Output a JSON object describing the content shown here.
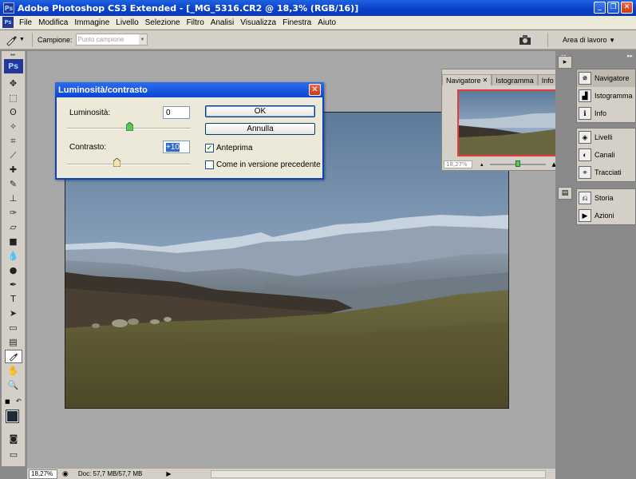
{
  "window": {
    "title": "Adobe Photoshop CS3 Extended - [_MG_5316.CR2 @ 18,3% (RGB/16)]",
    "app_icon_text": "Ps"
  },
  "menu": [
    "File",
    "Modifica",
    "Immagine",
    "Livello",
    "Selezione",
    "Filtro",
    "Analisi",
    "Visualizza",
    "Finestra",
    "Aiuto"
  ],
  "options_bar": {
    "sample_label": "Campione:",
    "sample_value": "Punto campione",
    "workspace_label": "Area di lavoro"
  },
  "toolbox": {
    "logo": "Ps"
  },
  "status_bar": {
    "zoom": "18,27%",
    "doc_info": "Doc: 57,7 MB/57,7 MB"
  },
  "dialog": {
    "title": "Luminosità/contrasto",
    "brightness_label": "Luminosità:",
    "brightness_value": "0",
    "brightness_level": 0,
    "contrast_label": "Contrasto:",
    "contrast_value": "+10",
    "contrast_level": 10,
    "ok_label": "OK",
    "cancel_label": "Annulla",
    "preview_label": "Anteprima",
    "preview_checked": true,
    "legacy_label": "Come in versione precedente",
    "legacy_checked": false
  },
  "navigator_panel": {
    "tabs": [
      "Navigatore",
      "Istogramma",
      "Info"
    ],
    "active_tab": "Navigatore",
    "zoom": "18,27%"
  },
  "right_dock": {
    "groups": [
      [
        {
          "label": "Navigatore",
          "icon": "navigator-icon"
        },
        {
          "label": "Istogramma",
          "icon": "histogram-icon"
        },
        {
          "label": "Info",
          "icon": "info-icon"
        }
      ],
      [
        {
          "label": "Livelli",
          "icon": "layers-icon"
        },
        {
          "label": "Canali",
          "icon": "channels-icon"
        },
        {
          "label": "Tracciati",
          "icon": "paths-icon"
        }
      ],
      [
        {
          "label": "Storia",
          "icon": "history-icon"
        },
        {
          "label": "Azioni",
          "icon": "actions-icon"
        }
      ]
    ]
  },
  "colors": {
    "foreground": "#1d2a39",
    "background": "#ffffff"
  }
}
